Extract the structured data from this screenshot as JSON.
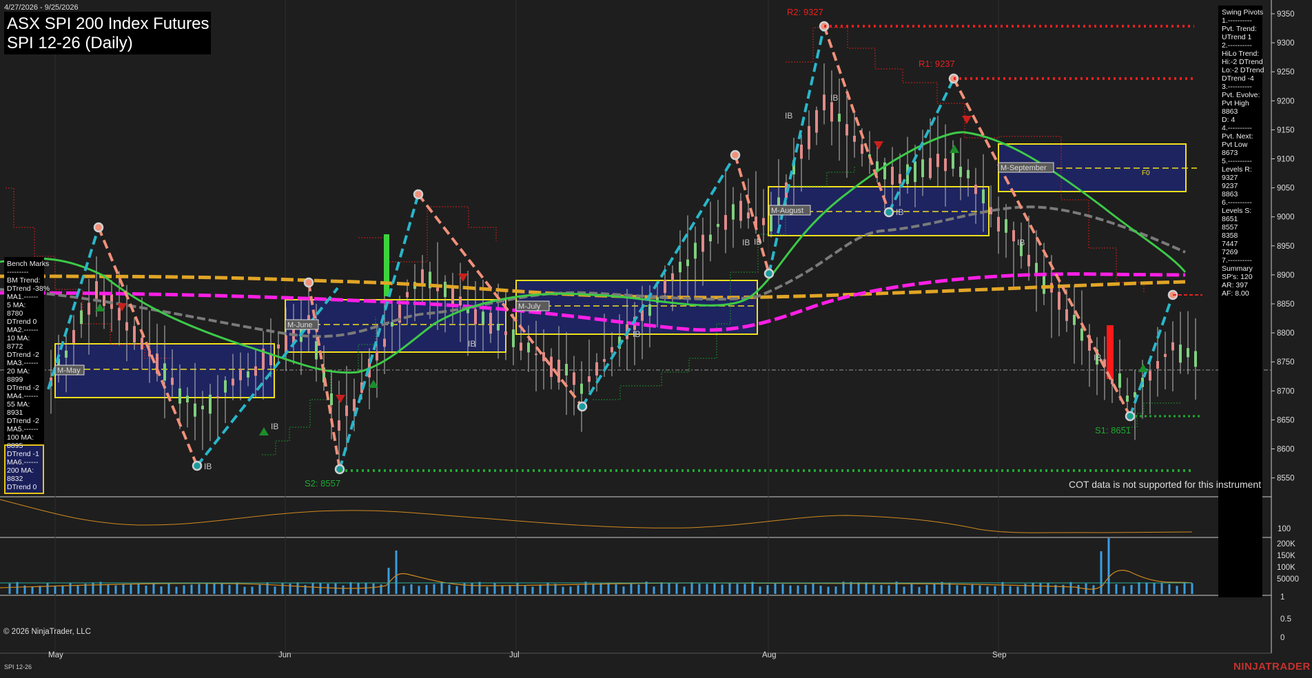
{
  "header": {
    "date_range": "4/27/2026 - 9/25/2026",
    "title_line1": "ASX SPI 200 Index Futures",
    "title_line2": "SPI 12-26 (Daily)"
  },
  "bench_marks": [
    "Bench Marks",
    "---------",
    "BM Trend:",
    "DTrend -38%",
    "MA1.------",
    "5 MA:",
    "8780",
    "DTrend 0",
    "MA2.------",
    "10 MA:",
    "8772",
    "DTrend -2",
    "MA3.------",
    "20 MA:",
    "8899",
    "DTrend -2",
    "MA4.------",
    "55 MA:",
    "8931",
    "DTrend -2",
    "MA5.------",
    "100 MA:",
    "8895",
    "DTrend -1",
    "MA6.------",
    "200 MA:",
    "8832",
    "DTrend 0"
  ],
  "swing_pivots": [
    "Swing Pivots",
    "1.----------",
    "Pvt. Trend:",
    "UTrend 1",
    "2.----------",
    "HiLo Trend:",
    "Hi:-2 DTrend",
    "Lo:-2 DTrend",
    "DTrend -4",
    "3.----------",
    "Pvt. Evolve:",
    "Pvt High",
    "8863",
    "D: 4",
    "4.----------",
    "Pvt. Next:",
    "Pvt Low",
    "8673",
    "5.----------",
    "Levels R:",
    "9327",
    "9237",
    "8863",
    "6.----------",
    "Levels S:",
    "8651",
    "8557",
    "8358",
    "7447",
    "7269",
    "7.----------",
    "Summary",
    "SP's: 120",
    "AR: 397",
    "AF: 8.00"
  ],
  "price_axis": [
    "9350",
    "9300",
    "9250",
    "9200",
    "9150",
    "9100",
    "9050",
    "9000",
    "8950",
    "8900",
    "8850",
    "8800",
    "8750",
    "8700",
    "8650",
    "8600",
    "8550"
  ],
  "osc_axis": [
    "100"
  ],
  "volume_axis": [
    "200K",
    "150K",
    "100K",
    "50000"
  ],
  "lower_axis": [
    "1",
    "0.5",
    "0"
  ],
  "time_axis": [
    "May",
    "Jun",
    "Jul",
    "Aug",
    "Sep"
  ],
  "levels": {
    "r2": "R2: 9327",
    "r1": "R1: 9237",
    "s1": "S1: 8651",
    "s2": "S2: 8557"
  },
  "month_boxes": [
    "M-May",
    "M-June",
    "M-July",
    "M-August",
    "M-September"
  ],
  "ib_labels": [
    "IB",
    "IB",
    "IB",
    "IB",
    "IB",
    "IB",
    "IB",
    "IB",
    "IB",
    "IB",
    "IB",
    "IB"
  ],
  "fo_label": "F0",
  "cot_message": "COT data is not supported for this instrument",
  "copyright": "© 2026 NinjaTrader, LLC",
  "instrument_tag": "SPI 12-26",
  "brand": "NINJATRADER",
  "colors": {
    "background": "#1e1e1e",
    "resistance": "#e8201f",
    "support": "#1fa832",
    "up_swing": "#29b6c9",
    "down_swing": "#f0907a",
    "ma_orange": "#e1a526",
    "ma_magenta": "#ff1fe6",
    "ma_green": "#3dc948",
    "ma_gray": "#7a7a7a",
    "box_border": "#f2e01a",
    "box_fill": "#1e2460"
  }
}
